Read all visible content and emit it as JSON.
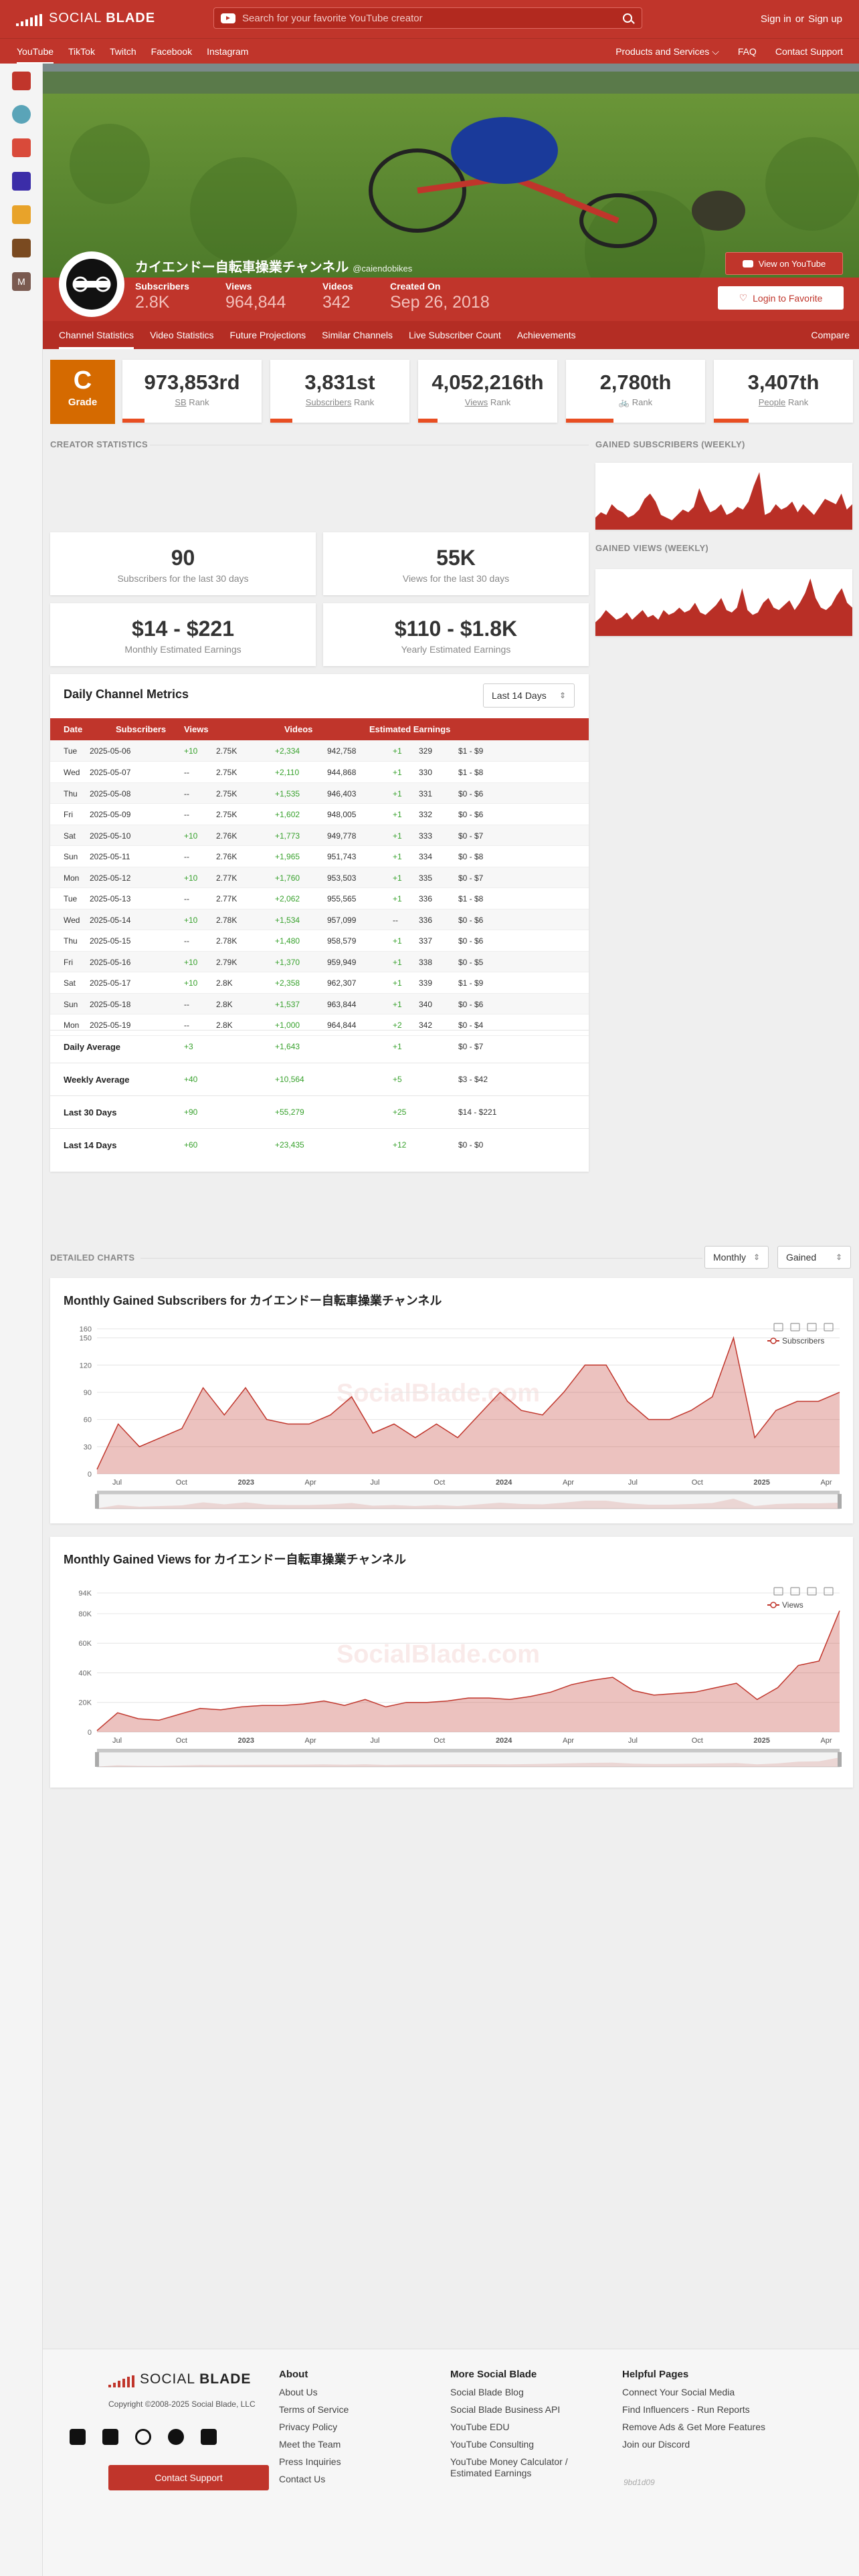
{
  "brand": {
    "name_light": "SOCIAL",
    "name_bold": "BLADE"
  },
  "search": {
    "placeholder": "Search for your favorite YouTube creator"
  },
  "auth": {
    "signin": "Sign in",
    "or": "or",
    "signup": "Sign up"
  },
  "nav": {
    "platforms": [
      "YouTube",
      "TikTok",
      "Twitch",
      "Facebook",
      "Instagram"
    ],
    "active_platform": "YouTube",
    "right": [
      "Products and Services",
      "FAQ",
      "Contact Support"
    ]
  },
  "sidebar_icons": [
    "youtube-icon",
    "channel-avatar-1",
    "channel-avatar-2",
    "channel-avatar-3",
    "channel-avatar-4",
    "channel-avatar-5",
    "channel-avatar-m"
  ],
  "sidebar_m": "M",
  "channel": {
    "name": "カイエンドー自転車操業チャンネル",
    "handle": "@caiendobikes",
    "stats": [
      {
        "label": "Subscribers",
        "value": "2.8K"
      },
      {
        "label": "Views",
        "value": "964,844"
      },
      {
        "label": "Videos",
        "value": "342"
      },
      {
        "label": "Created On",
        "value": "Sep 26, 2018"
      }
    ],
    "view_on_youtube": "View on YouTube",
    "login_favorite": "Login to Favorite"
  },
  "subtabs": [
    "Channel Statistics",
    "Video Statistics",
    "Future Projections",
    "Similar Channels",
    "Live Subscriber Count",
    "Achievements"
  ],
  "compare": "Compare",
  "grade": {
    "letter": "C",
    "label": "Grade"
  },
  "ranks": [
    {
      "value": "973,853rd",
      "prefix": "",
      "under": "SB",
      "suffix": " Rank",
      "fill": 0.16
    },
    {
      "value": "3,831st",
      "prefix": "",
      "under": "Subscribers",
      "suffix": " Rank",
      "fill": 0.16
    },
    {
      "value": "4,052,216th",
      "prefix": "",
      "under": "Views",
      "suffix": " Rank",
      "fill": 0.14
    },
    {
      "value": "2,780th",
      "prefix": "🚲 ",
      "under": "",
      "suffix": "Rank",
      "fill": 0.34
    },
    {
      "value": "3,407th",
      "prefix": "",
      "under": "People",
      "suffix": " Rank",
      "fill": 0.25
    }
  ],
  "sections": {
    "creator": "CREATOR STATISTICS",
    "gained_subs": "GAINED SUBSCRIBERS (WEEKLY)",
    "gained_views": "GAINED VIEWS (WEEKLY)",
    "detailed": "DETAILED CHARTS"
  },
  "summary": [
    {
      "value": "90",
      "label": "Subscribers for the last 30 days"
    },
    {
      "value": "55K",
      "label": "Views for the last 30 days"
    },
    {
      "value": "$14 - $221",
      "label": "Monthly Estimated Earnings"
    },
    {
      "value": "$110 - $1.8K",
      "label": "Yearly Estimated Earnings"
    }
  ],
  "daily": {
    "title": "Daily Channel Metrics",
    "range": "Last 14 Days",
    "headers": [
      "Date",
      "Subscribers",
      "Views",
      "Videos",
      "Estimated Earnings"
    ],
    "rows": [
      [
        "Tue",
        "2025-05-06",
        "+10",
        "2.75K",
        "+2,334",
        "942,758",
        "+1",
        "329",
        "$1 - $9"
      ],
      [
        "Wed",
        "2025-05-07",
        "--",
        "2.75K",
        "+2,110",
        "944,868",
        "+1",
        "330",
        "$1 - $8"
      ],
      [
        "Thu",
        "2025-05-08",
        "--",
        "2.75K",
        "+1,535",
        "946,403",
        "+1",
        "331",
        "$0 - $6"
      ],
      [
        "Fri",
        "2025-05-09",
        "--",
        "2.75K",
        "+1,602",
        "948,005",
        "+1",
        "332",
        "$0 - $6"
      ],
      [
        "Sat",
        "2025-05-10",
        "+10",
        "2.76K",
        "+1,773",
        "949,778",
        "+1",
        "333",
        "$0 - $7"
      ],
      [
        "Sun",
        "2025-05-11",
        "--",
        "2.76K",
        "+1,965",
        "951,743",
        "+1",
        "334",
        "$0 - $8"
      ],
      [
        "Mon",
        "2025-05-12",
        "+10",
        "2.77K",
        "+1,760",
        "953,503",
        "+1",
        "335",
        "$0 - $7"
      ],
      [
        "Tue",
        "2025-05-13",
        "--",
        "2.77K",
        "+2,062",
        "955,565",
        "+1",
        "336",
        "$1 - $8"
      ],
      [
        "Wed",
        "2025-05-14",
        "+10",
        "2.78K",
        "+1,534",
        "957,099",
        "--",
        "336",
        "$0 - $6"
      ],
      [
        "Thu",
        "2025-05-15",
        "--",
        "2.78K",
        "+1,480",
        "958,579",
        "+1",
        "337",
        "$0 - $6"
      ],
      [
        "Fri",
        "2025-05-16",
        "+10",
        "2.79K",
        "+1,370",
        "959,949",
        "+1",
        "338",
        "$0 - $5"
      ],
      [
        "Sat",
        "2025-05-17",
        "+10",
        "2.8K",
        "+2,358",
        "962,307",
        "+1",
        "339",
        "$1 - $9"
      ],
      [
        "Sun",
        "2025-05-18",
        "--",
        "2.8K",
        "+1,537",
        "963,844",
        "+1",
        "340",
        "$0 - $6"
      ],
      [
        "Mon",
        "2025-05-19",
        "--",
        "2.8K",
        "+1,000",
        "964,844",
        "+2",
        "342",
        "$0 - $4"
      ]
    ],
    "summary_rows": [
      [
        "Daily Average",
        "+3",
        "+1,643",
        "+1",
        "$0 - $7"
      ],
      [
        "Weekly Average",
        "+40",
        "+10,564",
        "+5",
        "$3 - $42"
      ],
      [
        "Last 30 Days",
        "+90",
        "+55,279",
        "+25",
        "$14 - $221"
      ],
      [
        "Last 14 Days",
        "+60",
        "+23,435",
        "+12",
        "$0 - $0"
      ]
    ]
  },
  "charts": {
    "period": "Monthly",
    "mode": "Gained",
    "watermark": "SocialBlade.com",
    "subs_title": "Monthly Gained Subscribers for カイエンドー自転車操業チャンネル",
    "views_title": "Monthly Gained Views for カイエンドー自転車操業チャンネル"
  },
  "chart_data": [
    {
      "type": "area",
      "title": "Monthly Gained Subscribers for カイエンドー自転車操業チャンネル",
      "legend": "Subscribers",
      "yticks": [
        "160",
        "150",
        "120",
        "90",
        "60",
        "30",
        "0"
      ],
      "ylim": [
        0,
        160
      ],
      "xticks": [
        "Jul",
        "Oct",
        "2023",
        "Apr",
        "Jul",
        "Oct",
        "2024",
        "Apr",
        "Jul",
        "Oct",
        "2025",
        "Apr"
      ],
      "values": [
        5,
        55,
        30,
        40,
        50,
        95,
        65,
        95,
        60,
        55,
        55,
        65,
        85,
        45,
        55,
        40,
        55,
        40,
        65,
        90,
        70,
        65,
        90,
        120,
        120,
        80,
        60,
        60,
        70,
        85,
        150,
        40,
        70,
        80,
        80,
        90
      ],
      "color": "#c0352b"
    },
    {
      "type": "area",
      "title": "Monthly Gained Views for カイエンドー自転車操業チャンネル",
      "legend": "Views",
      "yticks": [
        "94K",
        "80K",
        "60K",
        "40K",
        "20K",
        "0"
      ],
      "ylim": [
        0,
        94000
      ],
      "xticks": [
        "Jul",
        "Oct",
        "2023",
        "Apr",
        "Jul",
        "Oct",
        "2024",
        "Apr",
        "Jul",
        "Oct",
        "2025",
        "Apr"
      ],
      "values": [
        1000,
        13000,
        9000,
        8000,
        12000,
        16000,
        15000,
        17000,
        18000,
        18000,
        19000,
        21000,
        18000,
        22000,
        17000,
        20000,
        20000,
        21000,
        23000,
        23000,
        22000,
        24000,
        27000,
        32000,
        35000,
        37000,
        28000,
        25000,
        26000,
        27000,
        30000,
        33000,
        22000,
        30000,
        45000,
        48000,
        82000
      ],
      "color": "#c0352b"
    }
  ],
  "weekly_subs": [
    3,
    5,
    4,
    8,
    6,
    5,
    3,
    4,
    6,
    10,
    12,
    9,
    4,
    3,
    2,
    4,
    6,
    5,
    7,
    14,
    9,
    5,
    6,
    8,
    4,
    5,
    7,
    6,
    9,
    15,
    20,
    4,
    5,
    8,
    6,
    7,
    9,
    5,
    8,
    6,
    4,
    7,
    10,
    9,
    8,
    12,
    6,
    8
  ],
  "weekly_views": [
    4,
    6,
    9,
    7,
    5,
    6,
    8,
    5,
    7,
    9,
    6,
    7,
    5,
    9,
    7,
    8,
    10,
    8,
    9,
    12,
    8,
    7,
    9,
    11,
    14,
    9,
    8,
    10,
    18,
    9,
    7,
    8,
    12,
    14,
    10,
    9,
    11,
    13,
    9,
    12,
    16,
    22,
    14,
    10,
    9,
    11,
    15,
    18,
    12,
    10
  ],
  "footer": {
    "copyright": "Copyright ©2008-2025 Social Blade, LLC",
    "contact_support": "Contact Support",
    "social_icons": [
      "youtube-icon",
      "x-icon",
      "instagram-icon",
      "facebook-icon",
      "twitch-icon"
    ],
    "cols": [
      {
        "title": "About",
        "links": [
          "About Us",
          "Terms of Service",
          "Privacy Policy",
          "Meet the Team",
          "Press Inquiries",
          "Contact Us"
        ]
      },
      {
        "title": "More Social Blade",
        "links": [
          "Social Blade Blog",
          "Social Blade Business API",
          "YouTube EDU",
          "YouTube Consulting",
          "YouTube Money Calculator / Estimated Earnings"
        ]
      },
      {
        "title": "Helpful Pages",
        "links": [
          "Connect Your Social Media",
          "Find Influencers - Run Reports",
          "Remove Ads & Get More Features",
          "Join our Discord"
        ]
      }
    ],
    "signature": "9bd1d09"
  }
}
